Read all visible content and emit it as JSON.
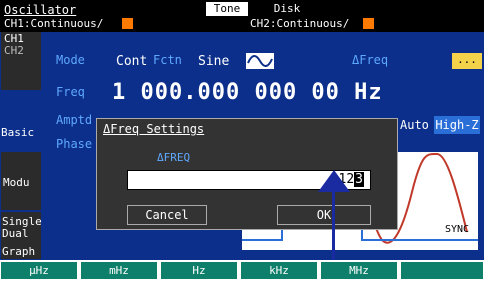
{
  "topbar": {
    "title": "Oscillator",
    "tone_label": "Tone",
    "disk_label": "Disk",
    "ch1_status": "CH1:Continuous/",
    "ch2_status": "CH2:Continuous/"
  },
  "sidebar": {
    "ch1": "CH1",
    "ch2": "CH2",
    "basic": "Basic",
    "modu": "Modu",
    "single": "Single",
    "dual": "Dual",
    "graph": "Graph"
  },
  "params": {
    "mode_label": "Mode",
    "mode_value": "Cont",
    "fctn_label": "Fctn",
    "fctn_value": "Sine",
    "delta_freq_label": "ΔFreq",
    "more_label": "...",
    "freq_label": "Freq",
    "freq_value": "1 000.000 000 00 Hz",
    "amptd_label": "Amptd",
    "phase_label": "Phase",
    "auto_label": "Auto",
    "highz_label": "High-Z"
  },
  "dialog": {
    "title": "ΔFreq Settings",
    "subtitle": "ΔFREQ",
    "value_prefix": "12",
    "value_cursor": "3",
    "cancel_label": "Cancel",
    "ok_label": "OK"
  },
  "graph": {
    "sync_label": "SYNC"
  },
  "softkeys": [
    "μHz",
    "mHz",
    "Hz",
    "kHz",
    "MHz"
  ],
  "colors": {
    "panel_blue": "#0b2f8a",
    "label_blue": "#5fa8ff",
    "softkey_teal": "#0d7f6a",
    "status_orange": "#ff7a00"
  }
}
